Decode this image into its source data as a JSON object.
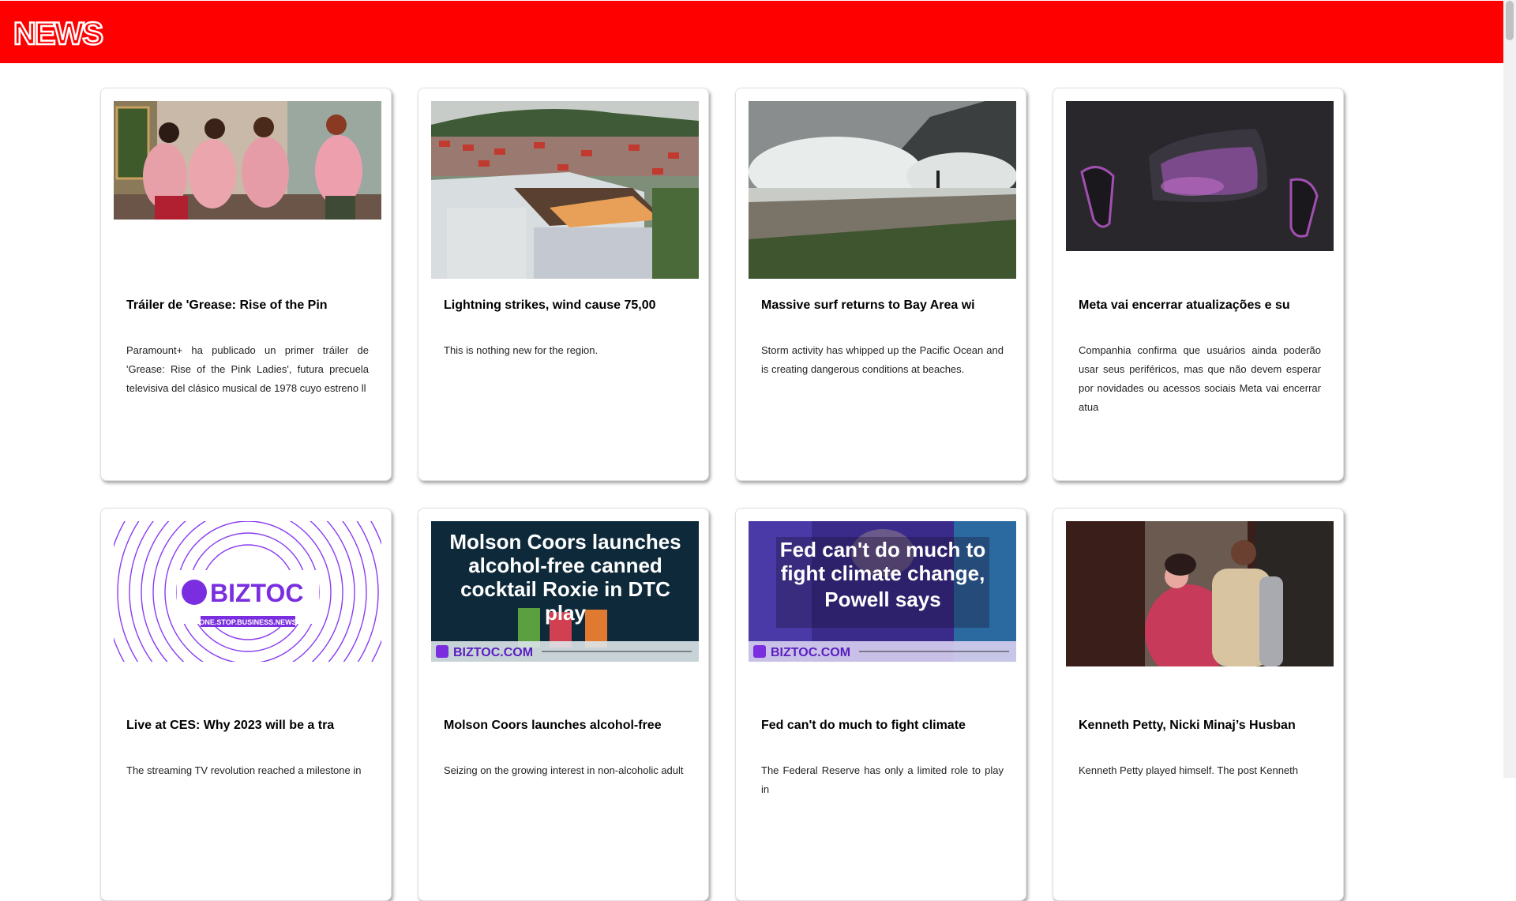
{
  "header": {
    "logo_text": "NEWS",
    "brand_color": "#ff0000"
  },
  "articles": [
    {
      "title": "Tráiler de 'Grease: Rise of the Pin",
      "description": "Paramount+ ha publicado un primer tráiler de 'Grease: Rise of the Pink Ladies', futura precuela televisiva del clásico musical de 1978 cuyo estreno ll"
    },
    {
      "title": "Lightning strikes, wind cause 75,00",
      "description": "This is nothing new for the region."
    },
    {
      "title": "Massive surf returns to Bay Area wi",
      "description": "Storm activity has whipped up the Pacific Ocean and is creating dangerous conditions at beaches."
    },
    {
      "title": "Meta vai encerrar atualizações e su",
      "description": "Companhia confirma que usuários ainda poderão usar seus periféricos, mas que não devem esperar por novidades ou acessos sociais Meta vai encerrar atua"
    },
    {
      "title": "Live at CES: Why 2023 will be a tra",
      "description": "The streaming TV revolution reached a milestone in",
      "image_text": {
        "brand": "BIZTOC",
        "tagline": "ONE.STOP.BUSINESS.NEWS"
      }
    },
    {
      "title": "Molson Coors launches alcohol-free",
      "description": "Seizing on the growing interest in non-alcoholic adult",
      "image_text": {
        "headline": [
          "Molson Coors launches",
          "alcohol-free canned",
          "cocktail Roxie in DTC",
          "play"
        ],
        "footer": "BIZTOC.COM"
      }
    },
    {
      "title": "Fed can't do much to fight climate",
      "description": "The Federal Reserve has only a limited role to play in",
      "image_text": {
        "headline": [
          "Fed can't do much to",
          "fight climate change,",
          "Powell says"
        ],
        "footer": "BIZTOC.COM"
      }
    },
    {
      "title": "Kenneth Petty, Nicki Minaj’s Husban",
      "description": "Kenneth Petty played himself. The post Kenneth"
    }
  ]
}
